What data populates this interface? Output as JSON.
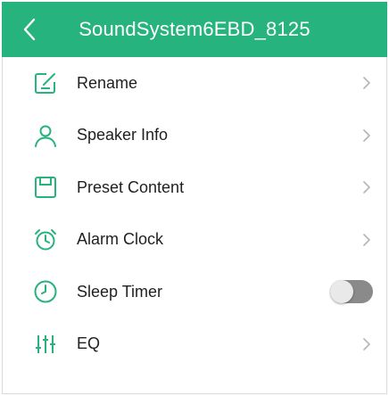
{
  "header": {
    "title": "SoundSystem6EBD_8125",
    "background_color": "#27b37e",
    "back_icon": "chevron-left-icon"
  },
  "menu": {
    "accent_color": "#27b37e",
    "items": [
      {
        "label": "Rename",
        "icon": "edit-icon",
        "trailing": "chevron"
      },
      {
        "label": "Speaker Info",
        "icon": "person-icon",
        "trailing": "chevron"
      },
      {
        "label": "Preset Content",
        "icon": "preset-icon",
        "trailing": "chevron"
      },
      {
        "label": "Alarm Clock",
        "icon": "alarm-clock-icon",
        "trailing": "chevron"
      },
      {
        "label": "Sleep Timer",
        "icon": "clock-icon",
        "trailing": "toggle",
        "toggle_on": false
      },
      {
        "label": "EQ",
        "icon": "equalizer-icon",
        "trailing": "chevron"
      }
    ]
  }
}
